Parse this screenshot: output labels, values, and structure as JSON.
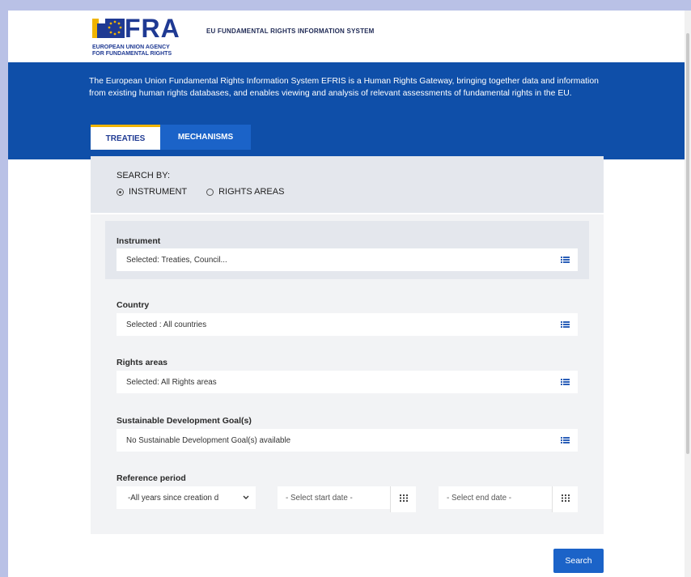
{
  "header": {
    "logo_word": "FRA",
    "logo_sub_line1": "EUROPEAN UNION AGENCY",
    "logo_sub_line2": "FOR FUNDAMENTAL RIGHTS",
    "system_title": "EU FUNDAMENTAL RIGHTS INFORMATION SYSTEM"
  },
  "banner": {
    "description": "The European Union Fundamental Rights Information System EFRIS is a Human Rights Gateway, bringing together data and information from existing human rights databases, and enables viewing and analysis of relevant assessments of fundamental rights in the EU."
  },
  "tabs": [
    {
      "label": "TREATIES",
      "active": true
    },
    {
      "label": "MECHANISMS",
      "active": false
    }
  ],
  "search_by": {
    "title": "SEARCH BY:",
    "options": [
      {
        "label": "INSTRUMENT",
        "selected": true
      },
      {
        "label": "RIGHTS AREAS",
        "selected": false
      }
    ]
  },
  "form": {
    "instrument": {
      "label": "Instrument",
      "value": "Selected: Treaties, Council..."
    },
    "country": {
      "label": "Country",
      "value": "Selected : All countries"
    },
    "rights_areas": {
      "label": "Rights areas",
      "value": "Selected: All Rights areas"
    },
    "sdg": {
      "label": "Sustainable Development Goal(s)",
      "value": "No Sustainable Development Goal(s) available"
    },
    "reference_period": {
      "label": "Reference period",
      "period_select": "-All years since creation d",
      "start_placeholder": "- Select start date -",
      "end_placeholder": "- Select end date -"
    }
  },
  "search_button": "Search",
  "colors": {
    "brand_blue": "#0f4fa9",
    "tab_blue": "#1b63c8",
    "accent_yellow": "#f0b400"
  }
}
